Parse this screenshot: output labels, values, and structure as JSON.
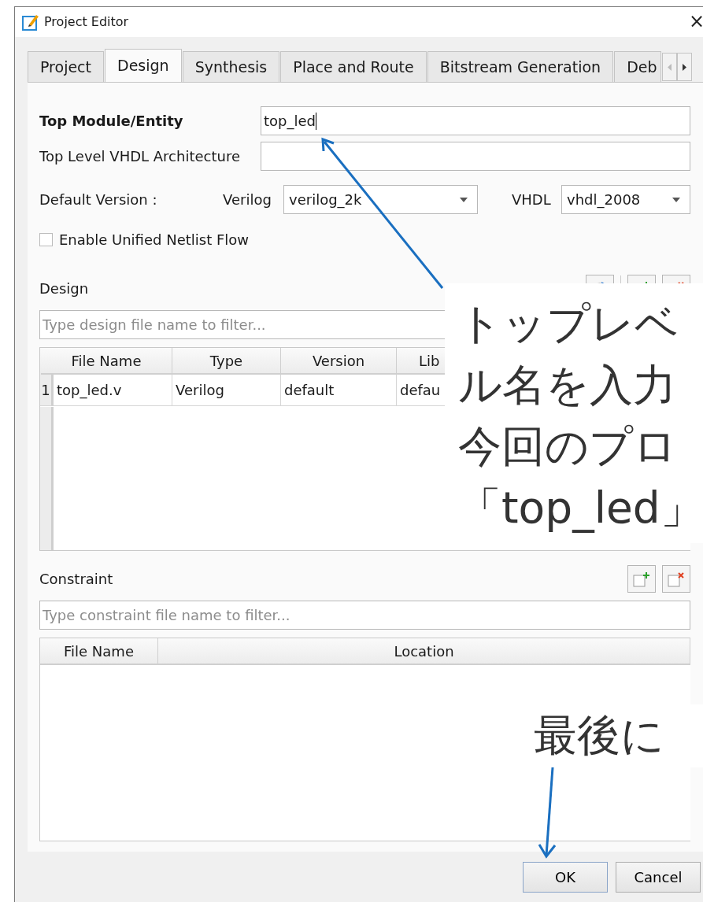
{
  "window": {
    "title": "Project Editor",
    "close": "×"
  },
  "tabs": [
    {
      "label": "Project",
      "selected": false
    },
    {
      "label": "Design",
      "selected": true
    },
    {
      "label": "Synthesis",
      "selected": false
    },
    {
      "label": "Place and Route",
      "selected": false
    },
    {
      "label": "Bitstream Generation",
      "selected": false
    },
    {
      "label": "Deb",
      "selected": false
    }
  ],
  "top_module": {
    "label": "Top Module/Entity",
    "value": "top_led"
  },
  "vhdl_architecture": {
    "label": "Top Level VHDL Architecture"
  },
  "default_version": {
    "label": "Default Version :",
    "verilog": {
      "label": "Verilog",
      "value": "verilog_2k"
    },
    "vhdl": {
      "label": "VHDL",
      "value": "vhdl_2008"
    }
  },
  "unified_netlist": {
    "label": "Enable Unified Netlist Flow",
    "checked": false
  },
  "design": {
    "title": "Design",
    "filter_placeholder": "Type design file name to filter...",
    "columns": [
      "File Name",
      "Type",
      "Version",
      "Lib"
    ],
    "rows": [
      {
        "number": "1",
        "cells": [
          "top_led.v",
          "Verilog",
          "default",
          "defau"
        ]
      }
    ]
  },
  "constraint": {
    "title": "Constraint",
    "filter_placeholder": "Type constraint file name to filter...",
    "columns": [
      "File Name",
      "Location"
    ]
  },
  "buttons": [
    {
      "label": "OK"
    },
    {
      "label": "Cancel"
    }
  ],
  "annotations": [
    {
      "lines": [
        "トップレベ",
        "ル名を入力",
        "今回のプロ",
        "「top_led」"
      ]
    },
    {
      "lines": [
        "最後に"
      ]
    }
  ]
}
